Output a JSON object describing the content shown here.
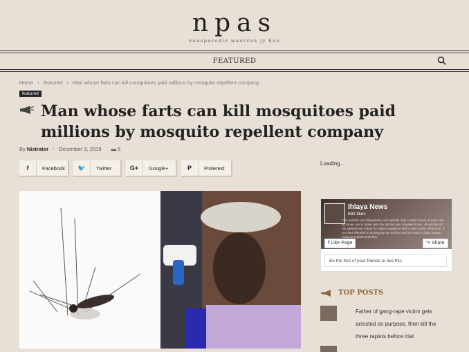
{
  "site": {
    "name": "npas",
    "tagline": "nuusparodie waarvan jy hou"
  },
  "nav": {
    "featured_label": "FEATURED",
    "search_icon": "search-icon"
  },
  "breadcrumb": {
    "home": "Home",
    "section": "featured",
    "current": "Man whose farts can kill mosquitoes paid millions by mosquito repellent company"
  },
  "article": {
    "badge": "featured",
    "title": "Man whose farts can kill mosquitoes paid millions by mosquito repellent company",
    "author_prefix": "By",
    "author": "Nistrator",
    "date": "December 9, 2019",
    "comments": "5"
  },
  "share": [
    {
      "label": "Facebook",
      "icon": "f"
    },
    {
      "label": "Twitter",
      "icon": "twitter-icon"
    },
    {
      "label": "Google+",
      "icon": "G+"
    },
    {
      "label": "Pinterest",
      "icon": "P"
    }
  ],
  "sidebar": {
    "loading": "Loading...",
    "fb_widget": {
      "page_name": "Ihlaya News",
      "likes": "883 likes",
      "description": "This website and ihlayanews.com website may contain traces of paint. We do all we can to make sure the articles are complete fiction. All articles on our website are meant for mature audience with a dark sense of humour. If you feel offended in anyway by our articles and you want to fight, please email us a place and time.",
      "like_label": "Like Page",
      "share_label": "Share",
      "friends_text": "Be the first of your friends to like this"
    },
    "top_posts_label": "TOP POSTS",
    "top_posts": [
      {
        "title_line1": "Father of gang-rape victim gets",
        "title_line2": "arrested on purpose, then kill the",
        "title_line3": "three rapists before trial"
      }
    ]
  }
}
